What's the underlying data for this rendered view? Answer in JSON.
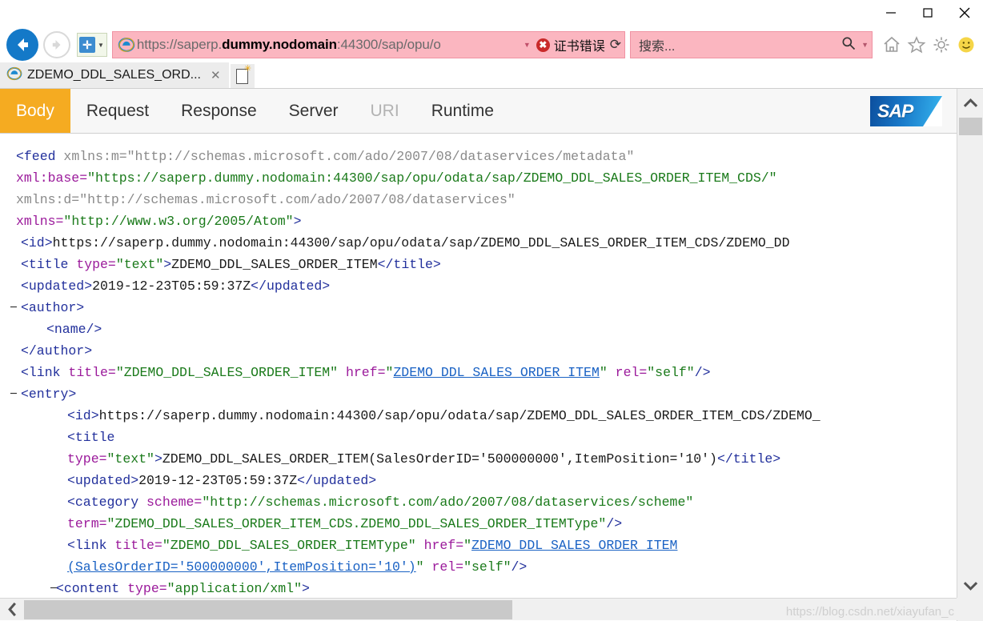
{
  "window": {
    "minimize_label": "—",
    "maximize_label": "□",
    "close_label": "✕"
  },
  "browser": {
    "back_icon": "back-arrow-icon",
    "forward_icon": "forward-arrow-icon",
    "compat_icon": "compatibility-view-icon",
    "compat_glyph": "✛",
    "address": {
      "prefix": "https://saperp.",
      "host": "dummy.nodomain",
      "suffix": ":44300/sap/opu/o",
      "dropdown_caret": "▼"
    },
    "certificate_error": {
      "label": "证书错误",
      "shield_glyph": "✖"
    },
    "refresh_glyph": "⟳",
    "search": {
      "placeholder": "搜索...",
      "icon_glyph": "🔍",
      "caret": "▼"
    },
    "tool_icons": [
      "home-icon",
      "favorites-star-icon",
      "settings-gear-icon",
      "smiley-feedback-icon"
    ],
    "tab": {
      "title": "ZDEMO_DDL_SALES_ORD...",
      "close_glyph": "✕",
      "new_tab_name": "new-tab-button"
    }
  },
  "sap_gateway": {
    "tabs": [
      {
        "label": "Body",
        "state": "active"
      },
      {
        "label": "Request",
        "state": "normal"
      },
      {
        "label": "Response",
        "state": "normal"
      },
      {
        "label": "Server",
        "state": "normal"
      },
      {
        "label": "URI",
        "state": "disabled"
      },
      {
        "label": "Runtime",
        "state": "normal"
      }
    ],
    "logo_text": "SAP"
  },
  "xml": {
    "line1_tag": "<feed",
    "line1_attr": " xmlns:m=",
    "line1_val": "\"http://schemas.microsoft.com/ado/2007/08/dataservices/metadata\"",
    "line2_attr": "xml:base=",
    "line2_val": "\"https://saperp.dummy.nodomain:44300/sap/opu/odata/sap/ZDEMO_DDL_SALES_ORDER_ITEM_CDS/\"",
    "line3_attr": "xmlns:d=",
    "line3_val": "\"http://schemas.microsoft.com/ado/2007/08/dataservices\"",
    "line4_attr": "xmlns=",
    "line4_val": "\"http://www.w3.org/2005/Atom\"",
    "line4_close": ">",
    "feed_id_open": "<id",
    "feed_id_gt": ">",
    "feed_id_text": "https://saperp.dummy.nodomain:44300/sap/opu/odata/sap/ZDEMO_DDL_SALES_ORDER_ITEM_CDS/ZDEMO_DD",
    "feed_title_open": "<title",
    "feed_title_attr": " type=",
    "feed_title_val": "\"text\"",
    "feed_title_gt": ">",
    "feed_title_text": "ZDEMO_DDL_SALES_ORDER_ITEM",
    "feed_title_close": "</title>",
    "feed_updated_open": "<updated>",
    "feed_updated_text": "2019-12-23T05:59:37Z",
    "feed_updated_close": "</updated>",
    "author_marker": "−",
    "author_open": "<author>",
    "name_self": "<name/>",
    "author_close": "</author>",
    "feed_link_open": "<link",
    "feed_link_title_attr": " title=",
    "feed_link_title_val": "\"ZDEMO_DDL_SALES_ORDER_ITEM\"",
    "feed_link_href_attr": " href=",
    "feed_link_href_q1": "\"",
    "feed_link_href_val": "ZDEMO_DDL_SALES_ORDER_ITEM",
    "feed_link_href_q2": "\"",
    "feed_link_rel_attr": " rel=",
    "feed_link_rel_val": "\"self\"",
    "feed_link_close": "/>",
    "entry_marker": "−",
    "entry_open": "<entry>",
    "entry_id_open": "<id",
    "entry_id_gt": ">",
    "entry_id_text": "https://saperp.dummy.nodomain:44300/sap/opu/odata/sap/ZDEMO_DDL_SALES_ORDER_ITEM_CDS/ZDEMO_",
    "entry_title_open": "<title",
    "entry_title_attr": "type=",
    "entry_title_val": "\"text\"",
    "entry_title_gt": ">",
    "entry_title_text": "ZDEMO_DDL_SALES_ORDER_ITEM(SalesOrderID='500000000',ItemPosition='10')",
    "entry_title_close": "</title>",
    "entry_updated_open": "<updated>",
    "entry_updated_text": "2019-12-23T05:59:37Z",
    "entry_updated_close": "</updated>",
    "category_open": "<category",
    "category_scheme_attr": " scheme=",
    "category_scheme_val": "\"http://schemas.microsoft.com/ado/2007/08/dataservices/scheme\"",
    "category_term_attr": "term=",
    "category_term_val": "\"ZDEMO_DDL_SALES_ORDER_ITEM_CDS.ZDEMO_DDL_SALES_ORDER_ITEMType\"",
    "category_close": "/>",
    "entry_link_open": "<link",
    "entry_link_title_attr": " title=",
    "entry_link_title_val": "\"ZDEMO_DDL_SALES_ORDER_ITEMType\"",
    "entry_link_href_attr": " href=",
    "entry_link_href_q1": "\"",
    "entry_link_href_val1": "ZDEMO_DDL_SALES_ORDER_ITEM",
    "entry_link_href_val2": "(SalesOrderID='500000000',ItemPosition='10')",
    "entry_link_href_q2": "\"",
    "entry_link_rel_attr": " rel=",
    "entry_link_rel_val": "\"self\"",
    "entry_link_close": "/>",
    "content_marker": "−",
    "content_open": "<content",
    "content_type_attr": " type=",
    "content_type_val": "\"application/xml\"",
    "content_gt": ">"
  },
  "scrollbars": {
    "v_up_glyph": "⌃",
    "v_down_glyph": "⌄",
    "h_left_glyph": "❮"
  },
  "watermark": "https://blog.csdn.net/xiayufan_c",
  "colors": {
    "accent_orange": "#f5ab21",
    "cert_error_pink": "#fbb6c0",
    "back_blue": "#1479c8",
    "tag_blue": "#22309c",
    "attr_purple": "#9b1a9b",
    "value_green": "#1a7a1a"
  }
}
